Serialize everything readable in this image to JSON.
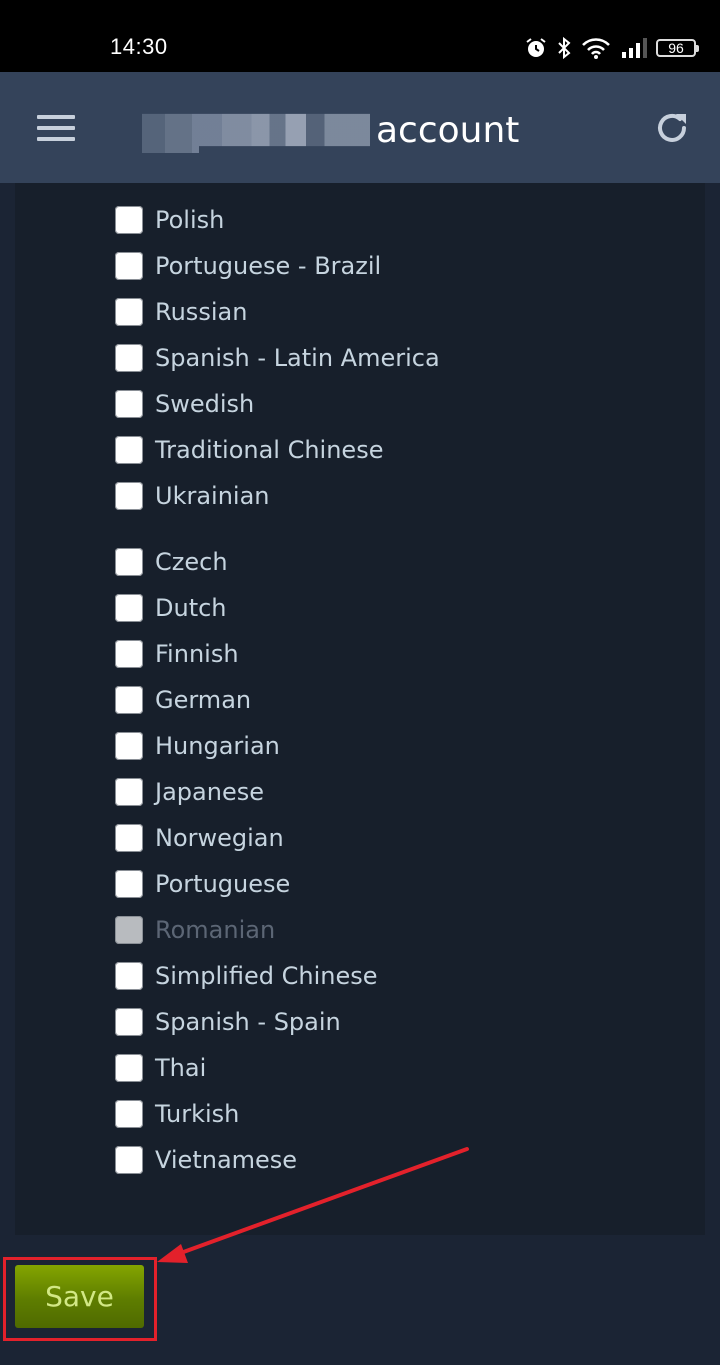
{
  "status_bar": {
    "time": "14:30",
    "icons": [
      "alarm-icon",
      "bluetooth-icon",
      "wifi-icon",
      "signal-icon"
    ],
    "battery": "96"
  },
  "header": {
    "title_suffix": "account",
    "title_redacted": true,
    "menu_icon": "hamburger-menu-icon",
    "refresh_icon": "refresh-icon"
  },
  "languages": {
    "group1": [
      {
        "label": "Polish",
        "checked": false,
        "disabled": false
      },
      {
        "label": "Portuguese - Brazil",
        "checked": false,
        "disabled": false
      },
      {
        "label": "Russian",
        "checked": false,
        "disabled": false
      },
      {
        "label": "Spanish - Latin America",
        "checked": false,
        "disabled": false
      },
      {
        "label": "Swedish",
        "checked": false,
        "disabled": false
      },
      {
        "label": "Traditional Chinese",
        "checked": false,
        "disabled": false
      },
      {
        "label": "Ukrainian",
        "checked": false,
        "disabled": false
      }
    ],
    "group2": [
      {
        "label": "Czech",
        "checked": false,
        "disabled": false
      },
      {
        "label": "Dutch",
        "checked": false,
        "disabled": false
      },
      {
        "label": "Finnish",
        "checked": false,
        "disabled": false
      },
      {
        "label": "German",
        "checked": false,
        "disabled": false
      },
      {
        "label": "Hungarian",
        "checked": false,
        "disabled": false
      },
      {
        "label": "Japanese",
        "checked": false,
        "disabled": false
      },
      {
        "label": "Norwegian",
        "checked": false,
        "disabled": false
      },
      {
        "label": "Portuguese",
        "checked": false,
        "disabled": false
      },
      {
        "label": "Romanian",
        "checked": false,
        "disabled": true
      },
      {
        "label": "Simplified Chinese",
        "checked": false,
        "disabled": false
      },
      {
        "label": "Spanish - Spain",
        "checked": false,
        "disabled": false
      },
      {
        "label": "Thai",
        "checked": false,
        "disabled": false
      },
      {
        "label": "Turkish",
        "checked": false,
        "disabled": false
      },
      {
        "label": "Vietnamese",
        "checked": false,
        "disabled": false
      }
    ]
  },
  "actions": {
    "save_label": "Save"
  },
  "annotation": {
    "color": "#e3212b",
    "target": "save-button"
  }
}
